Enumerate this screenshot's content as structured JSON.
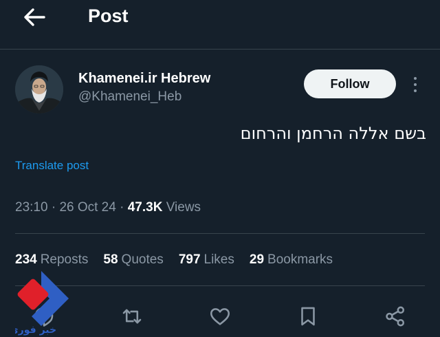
{
  "header": {
    "back_icon": "arrow-left-icon",
    "title": "Post"
  },
  "author": {
    "display_name": "Khamenei.ir Hebrew",
    "handle": "@Khamenei_Heb",
    "follow_label": "Follow"
  },
  "post": {
    "text": "בשם אללה הרחמן והרחום",
    "translate_label": "Translate post",
    "time": "23:10",
    "date": "26 Oct 24",
    "views_count": "47.3K",
    "views_label": "Views"
  },
  "stats": [
    {
      "count": "234",
      "label": "Reposts"
    },
    {
      "count": "58",
      "label": "Quotes"
    },
    {
      "count": "797",
      "label": "Likes"
    },
    {
      "count": "29",
      "label": "Bookmarks"
    }
  ],
  "actions": [
    "reply-icon",
    "repost-icon",
    "like-icon",
    "bookmark-icon",
    "share-icon"
  ],
  "watermark": {
    "text": "خبر فوری"
  },
  "colors": {
    "background": "#15202b",
    "link": "#1d9bf0",
    "secondary_text": "#8b98a5",
    "divider": "#38444d",
    "follow_bg": "#eff3f4"
  }
}
